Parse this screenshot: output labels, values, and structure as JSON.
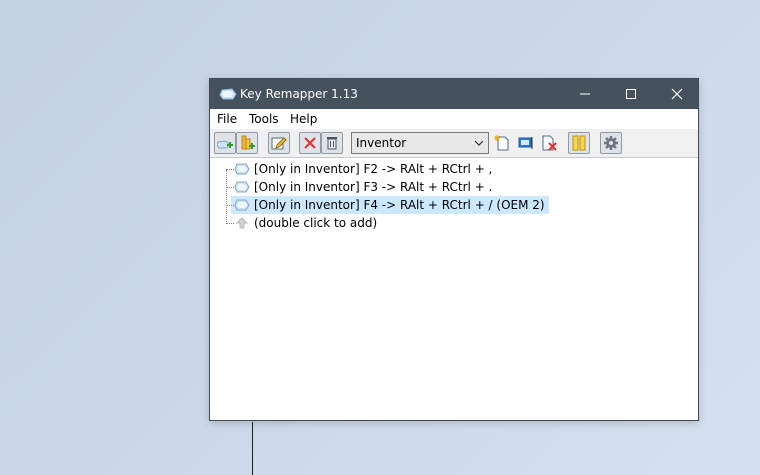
{
  "window": {
    "title": "Key Remapper 1.13"
  },
  "menu": [
    "File",
    "Tools",
    "Help"
  ],
  "toolbar": {
    "profile_selected": "Inventor"
  },
  "tree": {
    "items": [
      {
        "label": "[Only in Inventor] F2 -> RAlt + RCtrl + ,",
        "selected": false
      },
      {
        "label": "[Only in Inventor] F3 -> RAlt + RCtrl + .",
        "selected": false
      },
      {
        "label": "[Only in Inventor] F4 -> RAlt + RCtrl + / (OEM 2)",
        "selected": true
      },
      {
        "label": "(double click to add)",
        "selected": false
      }
    ]
  },
  "colors": {
    "titlebar": "#46515e",
    "selection": "#cce8ff"
  }
}
